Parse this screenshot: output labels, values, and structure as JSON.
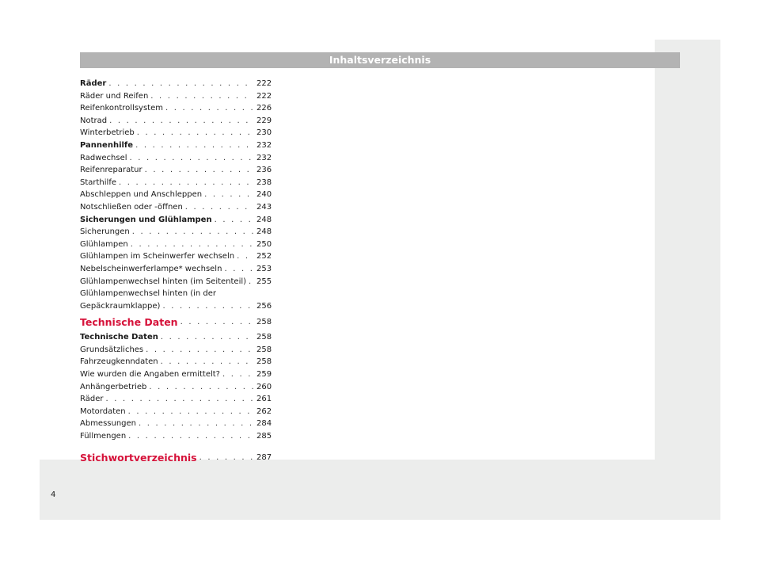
{
  "header": {
    "title": "Inhaltsverzeichnis"
  },
  "toc": {
    "entries": [
      {
        "text": "Räder",
        "page": "222",
        "style": "bold"
      },
      {
        "text": "Räder und Reifen",
        "page": "222",
        "style": "normal"
      },
      {
        "text": "Reifenkontrollsystem",
        "page": "226",
        "style": "normal"
      },
      {
        "text": "Notrad",
        "page": "229",
        "style": "normal"
      },
      {
        "text": "Winterbetrieb",
        "page": "230",
        "style": "normal"
      },
      {
        "text": "Pannenhilfe",
        "page": "232",
        "style": "bold"
      },
      {
        "text": "Radwechsel",
        "page": "232",
        "style": "normal"
      },
      {
        "text": "Reifenreparatur",
        "page": "236",
        "style": "normal"
      },
      {
        "text": "Starthilfe",
        "page": "238",
        "style": "normal"
      },
      {
        "text": "Abschleppen und Anschleppen",
        "page": "240",
        "style": "normal"
      },
      {
        "text": "Notschließen oder -öffnen",
        "page": "243",
        "style": "normal"
      },
      {
        "text": "Sicherungen und Glühlampen",
        "page": "248",
        "style": "bold"
      },
      {
        "text": "Sicherungen",
        "page": "248",
        "style": "normal"
      },
      {
        "text": "Glühlampen",
        "page": "250",
        "style": "normal"
      },
      {
        "text": "Glühlampen im Scheinwerfer wechseln",
        "page": "252",
        "style": "normal"
      },
      {
        "text": "Nebelscheinwerferlampe* wechseln",
        "page": "253",
        "style": "normal"
      },
      {
        "text": "Glühlampenwechsel hinten (im Seitenteil)",
        "page": "255",
        "style": "normal"
      },
      {
        "text": "Glühlampenwechsel hinten (in der",
        "page": "",
        "style": "cont"
      },
      {
        "text": "Gepäckraumklappe)",
        "page": "256",
        "style": "normal"
      },
      {
        "text": "Technische Daten",
        "page": "258",
        "style": "chapter"
      },
      {
        "text": "Technische Daten",
        "page": "258",
        "style": "bold"
      },
      {
        "text": "Grundsätzliches",
        "page": "258",
        "style": "normal"
      },
      {
        "text": "Fahrzeugkenndaten",
        "page": "258",
        "style": "normal"
      },
      {
        "text": "Wie wurden die Angaben ermittelt?",
        "page": "259",
        "style": "normal"
      },
      {
        "text": "Anhängerbetrieb",
        "page": "260",
        "style": "normal"
      },
      {
        "text": "Räder",
        "page": "261",
        "style": "normal"
      },
      {
        "text": "Motordaten",
        "page": "262",
        "style": "normal"
      },
      {
        "text": "Abmessungen",
        "page": "284",
        "style": "normal"
      },
      {
        "text": "Füllmengen",
        "page": "285",
        "style": "normal"
      },
      {
        "text": "Stichwortverzeichnis",
        "page": "287",
        "style": "chapter-last"
      }
    ]
  },
  "footer": {
    "page_number": "4"
  },
  "colors": {
    "chapter": "#d6123a",
    "header_bar": "#b3b3b3"
  }
}
